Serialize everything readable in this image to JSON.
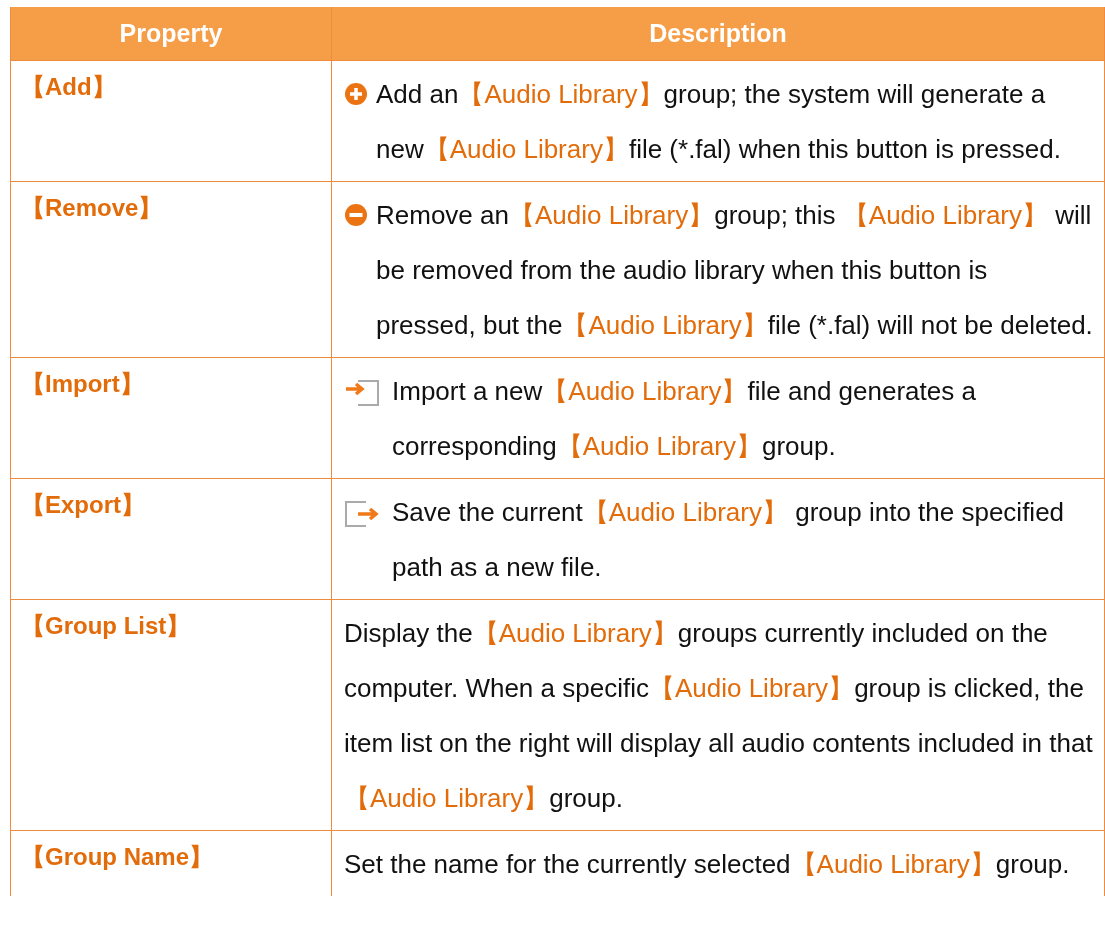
{
  "table": {
    "columns": [
      "Property",
      "Description"
    ],
    "rows": [
      {
        "property": "【Add】",
        "description": [
          {
            "kind": "text",
            "text": "Add an"
          },
          {
            "kind": "ref",
            "text": "【Audio Library】"
          },
          {
            "kind": "text",
            "text": "group; the system will generate a new"
          },
          {
            "kind": "ref",
            "text": "【Audio Library】"
          },
          {
            "kind": "text",
            "text": "file (*.fal) when this button is pressed."
          }
        ]
      },
      {
        "property": "【Remove】",
        "description": [
          {
            "kind": "text",
            "text": "Remove an"
          },
          {
            "kind": "ref",
            "text": "【Audio Library】"
          },
          {
            "kind": "text",
            "text": "group; this "
          },
          {
            "kind": "ref",
            "text": "【Audio Library】"
          },
          {
            "kind": "text",
            "text": " will be removed from the audio library when this button is pressed, but the"
          },
          {
            "kind": "ref",
            "text": "【Audio Library】"
          },
          {
            "kind": "text",
            "text": "file (*.fal) will not be deleted."
          }
        ]
      },
      {
        "property": "【Import】",
        "description": [
          {
            "kind": "text",
            "text": "Import a new"
          },
          {
            "kind": "ref",
            "text": "【Audio Library】"
          },
          {
            "kind": "text",
            "text": "file and generates a corresponding"
          },
          {
            "kind": "ref",
            "text": "【Audio Library】"
          },
          {
            "kind": "text",
            "text": "group."
          }
        ]
      },
      {
        "property": "【Export】",
        "description": [
          {
            "kind": "text",
            "text": "Save the current"
          },
          {
            "kind": "ref",
            "text": "【Audio Library】"
          },
          {
            "kind": "text",
            "text": " group into the specified path as a new file."
          }
        ]
      },
      {
        "property": "【Group List】",
        "description": [
          {
            "kind": "text",
            "text": "Display the"
          },
          {
            "kind": "ref",
            "text": "【Audio Library】"
          },
          {
            "kind": "text",
            "text": "groups currently included on the computer. When a specific"
          },
          {
            "kind": "ref",
            "text": "【Audio Library】"
          },
          {
            "kind": "text",
            "text": "group is clicked, the item list on the right will display all audio contents included in that"
          },
          {
            "kind": "ref",
            "text": "【Audio Library】"
          },
          {
            "kind": "text",
            "text": "group."
          }
        ]
      },
      {
        "property": "【Group Name】",
        "description": [
          {
            "kind": "text",
            "text": "Set the name for the currently selected"
          },
          {
            "kind": "ref",
            "text": "【Audio Library】"
          },
          {
            "kind": "text",
            "text": "group."
          }
        ]
      }
    ]
  }
}
